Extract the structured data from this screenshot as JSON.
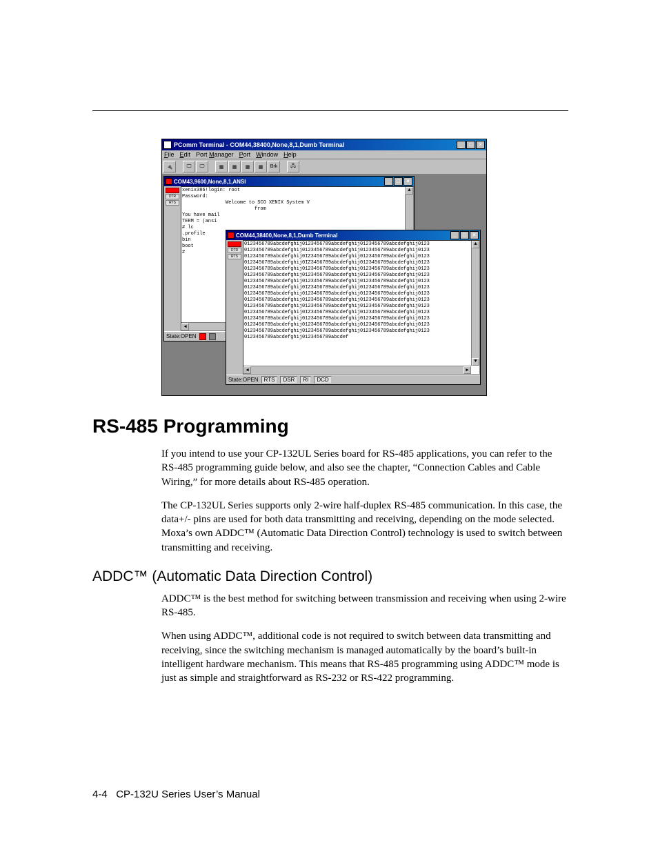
{
  "app": {
    "title": "PComm Terminal - COM44,38400,None,8,1,Dumb Terminal",
    "menus": {
      "file": "File",
      "edit": "Edit",
      "portmgr": "Port Manager",
      "port": "Port",
      "window": "Window",
      "help": "Help"
    },
    "toolbar_brk": "Brk"
  },
  "win1": {
    "title": "COM43,9600,None,8,1,ANSI",
    "leds": {
      "dtr": "DTR",
      "rts": "RTS"
    },
    "lines": {
      "l1": "xenix386!login: root",
      "l2": "Password:",
      "l3": "",
      "l4": "               Welcome to SCO XENIX System V",
      "l5": "",
      "l6": "                         from",
      "l7": "",
      "l8": "You have mail",
      "l9": "TERM = (ansi",
      "l10": "# lc",
      "l11": ".profile",
      "l12": "bin",
      "l13": "boot",
      "l14": "#"
    },
    "status_state": "State:OPEN"
  },
  "win2": {
    "title": "COM44,38400,None,8,1,Dumb Terminal",
    "leds": {
      "dtr": "DTR",
      "rts": "RTS"
    },
    "pattern_full": "0123456789abcdefghij0123456789abcdefghij0123456789abcdefghij0123",
    "pattern_alt": "0123456789abcdefghij0IZ3456789abcdefghij0123456789abcdefghij0123",
    "pattern_last": "0123456789abcdefghij0123456789abcdef",
    "status_state": "State:OPEN",
    "st": {
      "a": "RTS",
      "b": "DSR",
      "c": "RI",
      "d": "DCD"
    }
  },
  "doc": {
    "h1": "RS-485 Programming",
    "p1": "If you intend to use your CP-132UL Series board for RS-485 applications, you can refer to the RS-485 programming guide below, and also see the chapter, “Connection Cables and Cable Wiring,” for more details about RS-485 operation.",
    "p2": "The CP-132UL Series supports only 2-wire half-duplex RS-485 communication. In this case, the data+/- pins are used for both data transmitting and receiving, depending on the mode selected. Moxa’s own ADDC™ (Automatic Data Direction Control) technology is used to switch between transmitting and receiving.",
    "h2": "ADDC™ (Automatic Data Direction Control)",
    "p3": "ADDC™ is the best method for switching between transmission and receiving when using 2-wire RS-485.",
    "p4": "When using ADDC™, additional code is not required to switch between data transmitting and receiving, since the switching mechanism is managed automatically by the board’s built-in intelligent hardware mechanism. This means that RS-485 programming using ADDC™ mode is just as simple and straightforward as RS-232 or RS-422 programming."
  },
  "footer": {
    "pagenum": "4-4",
    "manual": "CP-132U Series User’s Manual"
  }
}
